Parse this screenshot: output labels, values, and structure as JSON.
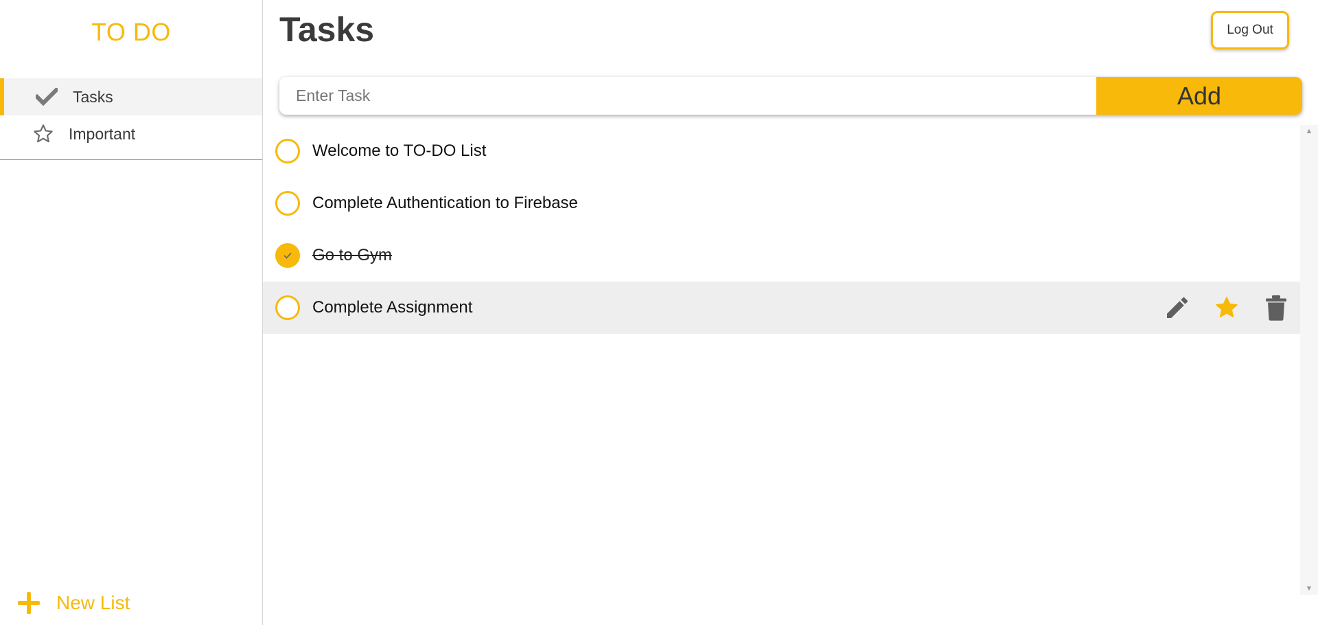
{
  "brand": {
    "title": "TO DO",
    "color": "#f8b90b"
  },
  "sidebar": {
    "items": [
      {
        "label": "Tasks",
        "icon": "checkmark-icon",
        "active": true
      },
      {
        "label": "Important",
        "icon": "star-outline-icon",
        "active": false
      }
    ],
    "new_list_label": "New List"
  },
  "header": {
    "title": "Tasks",
    "logout_label": "Log Out"
  },
  "add_task": {
    "placeholder": "Enter Task",
    "value": "",
    "button_label": "Add"
  },
  "tasks": [
    {
      "text": "Welcome to TO-DO List",
      "completed": false
    },
    {
      "text": "Complete Authentication to Firebase",
      "completed": false
    },
    {
      "text": "Go to Gym",
      "completed": true
    },
    {
      "text": "Complete Assignment",
      "completed": false,
      "hovered": true,
      "important": true
    }
  ],
  "task_actions": [
    "edit-icon",
    "star-icon",
    "trash-icon"
  ]
}
